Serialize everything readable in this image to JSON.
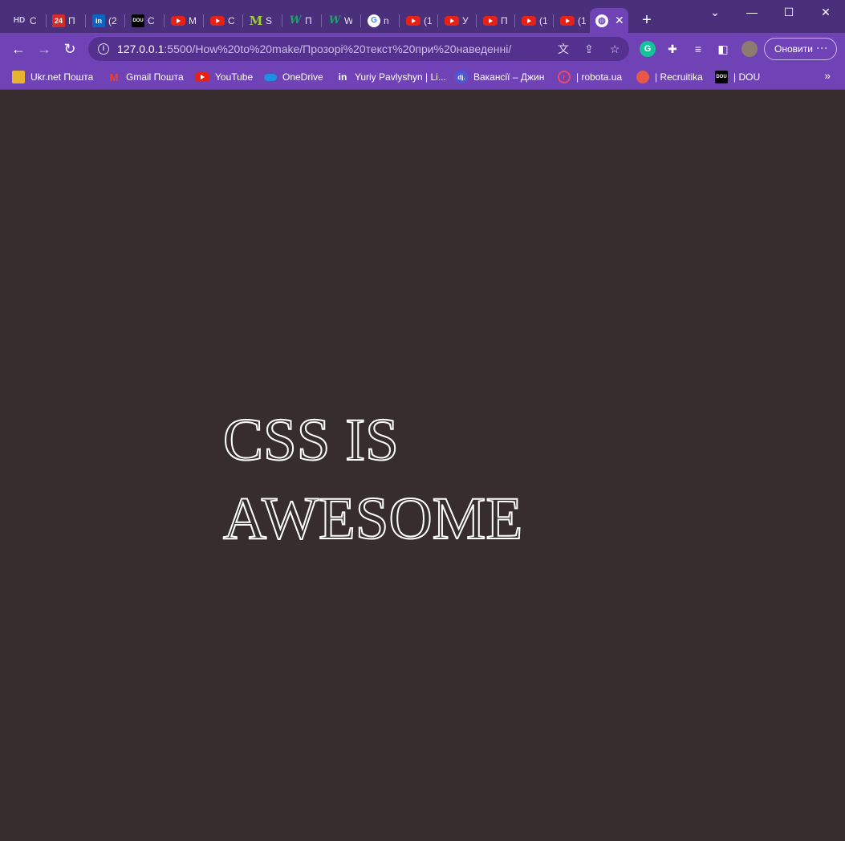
{
  "tabs": [
    {
      "favicon": "hd-icon",
      "label": "C"
    },
    {
      "favicon": "24-icon",
      "label": "П"
    },
    {
      "favicon": "linkedin-icon",
      "label": "(2"
    },
    {
      "favicon": "dou-icon",
      "label": "C"
    },
    {
      "favicon": "youtube-icon",
      "label": "M"
    },
    {
      "favicon": "youtube-icon",
      "label": "C"
    },
    {
      "favicon": "m-icon",
      "label": "S"
    },
    {
      "favicon": "w-icon",
      "label": "П"
    },
    {
      "favicon": "w-icon",
      "label": "W"
    },
    {
      "favicon": "google-icon",
      "label": "n"
    },
    {
      "favicon": "youtube-icon",
      "label": "(1"
    },
    {
      "favicon": "youtube-icon",
      "label": "У"
    },
    {
      "favicon": "youtube-icon",
      "label": "П"
    },
    {
      "favicon": "youtube-icon",
      "label": "(1"
    },
    {
      "favicon": "youtube-icon",
      "label": "(1"
    }
  ],
  "active_tab": {
    "favicon": "globe-icon",
    "close": "✕"
  },
  "new_tab": "+",
  "window_controls": {
    "dropdown": "⌄",
    "minimize": "—",
    "maximize": "☐",
    "close": "✕"
  },
  "address_bar": {
    "host": "127.0.0.1",
    "path": ":5500/How%20to%20make/Прозорі%20текст%20при%20наведенні/"
  },
  "update_button": {
    "label": "Оновити"
  },
  "bookmarks": [
    {
      "favicon": "ukrnet-icon",
      "label": "Ukr.net Пошта"
    },
    {
      "favicon": "gmail-icon",
      "label": "Gmail Пошта"
    },
    {
      "favicon": "youtube-icon",
      "label": "YouTube"
    },
    {
      "favicon": "onedrive-icon",
      "label": "OneDrive"
    },
    {
      "favicon": "linkedin-icon",
      "label": "Yuriy Pavlyshyn | Li..."
    },
    {
      "favicon": "djinni-icon",
      "label": "Вакансії – Джин"
    },
    {
      "favicon": "robota-icon",
      "label": "| robota.ua"
    },
    {
      "favicon": "recruitika-icon",
      "label": "| Recruitika"
    },
    {
      "favicon": "dou-icon",
      "label": "| DOU"
    }
  ],
  "bookmarks_more": "»",
  "page": {
    "headline": "CSS is awesome",
    "background": "#372c2e",
    "text_stroke_color": "#ffffff"
  },
  "colors": {
    "browser_frame": "#4a2f7b",
    "browser_toolbar": "#6f43b6"
  }
}
